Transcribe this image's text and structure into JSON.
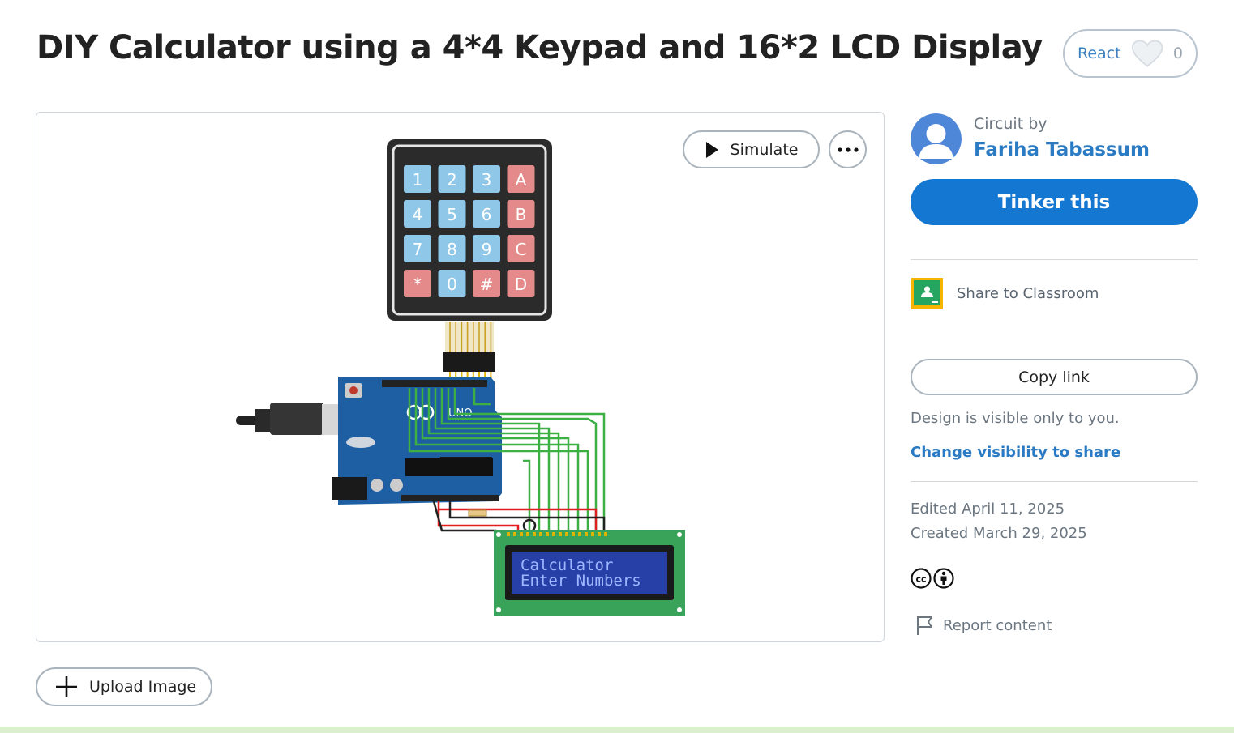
{
  "page": {
    "title": "DIY Calculator using a 4*4 Keypad and 16*2 LCD Display"
  },
  "react": {
    "label": "React",
    "count": "0",
    "icon": "heart-icon"
  },
  "canvas": {
    "simulate_label": "Simulate",
    "play_icon": "play-icon",
    "more_icon": "more-horizontal-icon",
    "keypad_keys": [
      "1",
      "2",
      "3",
      "A",
      "4",
      "5",
      "6",
      "B",
      "7",
      "8",
      "9",
      "C",
      "*",
      "0",
      "#",
      "D"
    ],
    "board_label": "UNO",
    "lcd_line1": "Calculator",
    "lcd_line2": "Enter Numbers"
  },
  "upload": {
    "label": "Upload Image",
    "icon": "plus-icon"
  },
  "author": {
    "prefix": "Circuit by",
    "name": "Fariha Tabassum"
  },
  "actions": {
    "tinker_label": "Tinker this",
    "share_classroom_label": "Share to Classroom",
    "copy_link_label": "Copy link"
  },
  "visibility": {
    "note": "Design is visible only to you.",
    "change_link": "Change visibility to share"
  },
  "dates": {
    "edited": "Edited April 11, 2025",
    "created": "Created March 29, 2025"
  },
  "report": {
    "label": "Report content",
    "icon": "flag-icon"
  },
  "colors": {
    "accent": "#1477d1",
    "link": "#2a7bc4",
    "board": "#1e5fa3",
    "lcd_pcb": "#3aa35a",
    "lcd_screen": "#2640a8",
    "key_blue": "#8ec7e8",
    "key_red": "#e58a8a"
  }
}
